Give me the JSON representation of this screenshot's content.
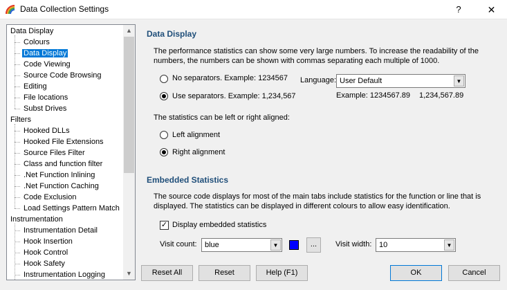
{
  "window": {
    "title": "Data Collection Settings",
    "help_label": "?",
    "close_label": "✕"
  },
  "tree": {
    "items": [
      {
        "label": "Data Display",
        "level": 0
      },
      {
        "label": "Colours",
        "level": 1
      },
      {
        "label": "Data Display",
        "level": 1,
        "selected": true
      },
      {
        "label": "Code Viewing",
        "level": 1
      },
      {
        "label": "Source Code Browsing",
        "level": 1
      },
      {
        "label": "Editing",
        "level": 1
      },
      {
        "label": "File locations",
        "level": 1
      },
      {
        "label": "Subst Drives",
        "level": 1
      },
      {
        "label": "Filters",
        "level": 0
      },
      {
        "label": "Hooked DLLs",
        "level": 1
      },
      {
        "label": "Hooked File Extensions",
        "level": 1
      },
      {
        "label": "Source Files Filter",
        "level": 1
      },
      {
        "label": "Class and function filter",
        "level": 1
      },
      {
        "label": ".Net Function Inlining",
        "level": 1
      },
      {
        "label": ".Net Function Caching",
        "level": 1
      },
      {
        "label": "Code Exclusion",
        "level": 1
      },
      {
        "label": "Load Settings Pattern Match",
        "level": 1
      },
      {
        "label": "Instrumentation",
        "level": 0
      },
      {
        "label": "Instrumentation Detail",
        "level": 1
      },
      {
        "label": "Hook Insertion",
        "level": 1
      },
      {
        "label": "Hook Control",
        "level": 1
      },
      {
        "label": "Hook Safety",
        "level": 1
      },
      {
        "label": "Instrumentation Logging",
        "level": 1
      }
    ],
    "scroll_up": "▲",
    "scroll_down": "▼"
  },
  "data_display": {
    "heading": "Data Display",
    "description": "The performance statistics can show some very large numbers. To increase the readability of the numbers, the numbers can be shown with commas separating each multiple of 1000.",
    "no_separators_label": "No separators. Example: 1234567",
    "use_separators_label": "Use separators. Example: 1,234,567",
    "separator_choice": "use",
    "language_label": "Language:",
    "language_value": "User Default",
    "example_label": "Example: 1234567.89",
    "example_value": "1,234,567.89",
    "align_text": "The statistics can be left or right aligned:",
    "left_align_label": "Left alignment",
    "right_align_label": "Right alignment",
    "alignment_choice": "right"
  },
  "embedded": {
    "heading": "Embedded Statistics",
    "description": "The source code displays for most of the main tabs include statistics for the function or line that is displayed. The statistics can be displayed in different colours to allow easy identification.",
    "display_label": "Display embedded statistics",
    "display_checked": true,
    "visit_count_label": "Visit count:",
    "visit_count_value": "blue",
    "swatch_color": "#0000ff",
    "ellipsis_label": "...",
    "visit_width_label": "Visit width:",
    "visit_width_value": "10"
  },
  "buttons": {
    "reset_all": "Reset All",
    "reset": "Reset",
    "help": "Help (F1)",
    "ok": "OK",
    "cancel": "Cancel"
  }
}
